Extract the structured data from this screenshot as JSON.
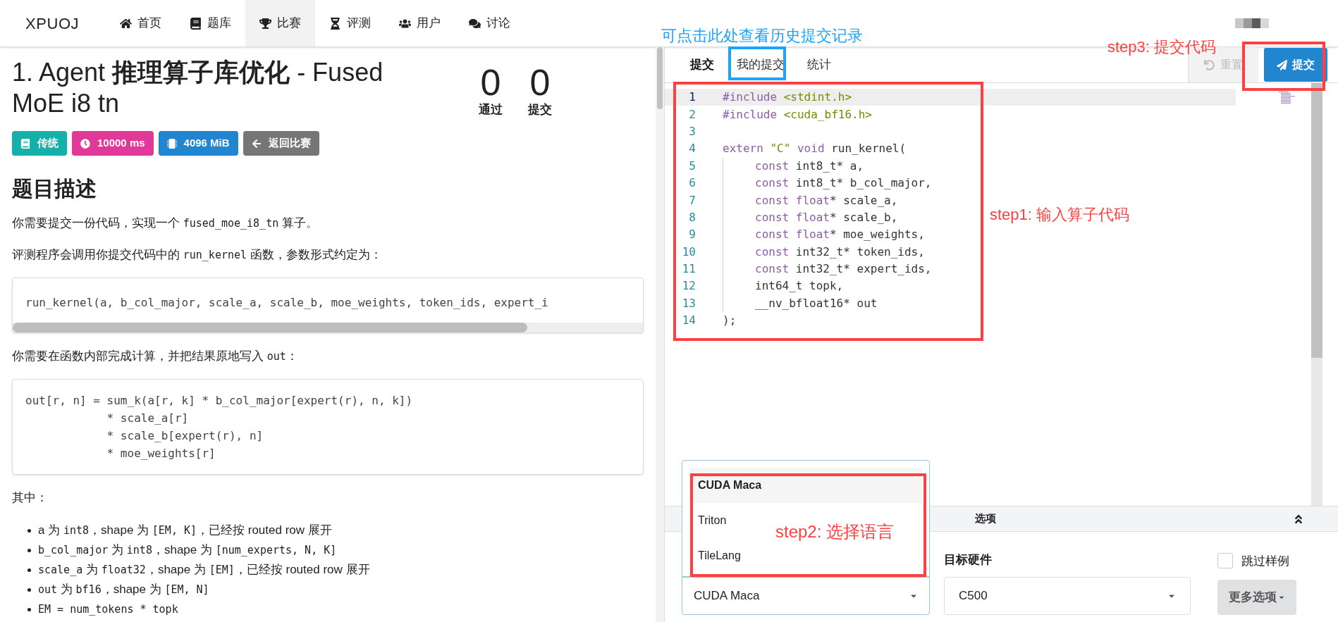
{
  "nav": {
    "logo": "XPUOJ",
    "items": [
      {
        "label": "首页",
        "selected": false
      },
      {
        "label": "题库",
        "selected": false
      },
      {
        "label": "比赛",
        "selected": true
      },
      {
        "label": "评测",
        "selected": false
      },
      {
        "label": "用户",
        "selected": false
      },
      {
        "label": "讨论",
        "selected": false
      }
    ]
  },
  "problem": {
    "title": "1. Agent **推理算子库优化** - Fused MoE i8 tn",
    "stats": [
      {
        "value": "0",
        "label": "通过"
      },
      {
        "value": "0",
        "label": "提交"
      }
    ],
    "badges": [
      {
        "label": "传统",
        "color": "#14b1ab"
      },
      {
        "label": "10000 ms",
        "color": "#e03997"
      },
      {
        "label": "4096 MiB",
        "color": "#2185d0"
      },
      {
        "label": "返回比赛",
        "color": "#767676"
      }
    ],
    "heading": "题目描述",
    "body": [
      {
        "kind": "paragraph",
        "segments": [
          {
            "kind": "text",
            "text": "你需要提交一份代码，实现一个 "
          },
          {
            "kind": "code",
            "text": "fused_moe_i8_tn"
          },
          {
            "kind": "text",
            "text": " 算子。"
          }
        ]
      },
      {
        "kind": "paragraph",
        "segments": [
          {
            "kind": "text",
            "text": "评测程序会调用你提交代码中的 "
          },
          {
            "kind": "code",
            "text": "run_kernel"
          },
          {
            "kind": "text",
            "text": " 函数，参数形式约定为："
          }
        ]
      },
      {
        "kind": "codeblock",
        "scrollbar": true,
        "lines": [
          "run_kernel(a, b_col_major, scale_a, scale_b, moe_weights, token_ids, expert_i"
        ]
      },
      {
        "kind": "paragraph",
        "segments": [
          {
            "kind": "text",
            "text": "你需要在函数内部完成计算，并把结果原地写入 "
          },
          {
            "kind": "code",
            "text": "out"
          },
          {
            "kind": "text",
            "text": "："
          }
        ]
      },
      {
        "kind": "codeblock",
        "scrollbar": false,
        "lines": [
          "out[r, n] = sum_k(a[r, k] * b_col_major[expert(r), n, k])",
          "            * scale_a[r]",
          "            * scale_b[expert(r), n]",
          "            * moe_weights[r]"
        ]
      },
      {
        "kind": "paragraph",
        "segments": [
          {
            "kind": "text",
            "text": "其中："
          }
        ]
      },
      {
        "kind": "list",
        "items": [
          [
            {
              "kind": "text",
              "text": "a 为 "
            },
            {
              "kind": "code",
              "text": "int8"
            },
            {
              "kind": "text",
              "text": "，shape 为 "
            },
            {
              "kind": "code",
              "text": "[EM, K]"
            },
            {
              "kind": "text",
              "text": "，已经按 routed row 展开"
            }
          ],
          [
            {
              "kind": "code",
              "text": "b_col_major"
            },
            {
              "kind": "text",
              "text": " 为 "
            },
            {
              "kind": "code",
              "text": "int8"
            },
            {
              "kind": "text",
              "text": "，shape 为 "
            },
            {
              "kind": "code",
              "text": "[num_experts, N, K]"
            }
          ],
          [
            {
              "kind": "code",
              "text": "scale_a"
            },
            {
              "kind": "text",
              "text": " 为 "
            },
            {
              "kind": "code",
              "text": "float32"
            },
            {
              "kind": "text",
              "text": "，shape 为 "
            },
            {
              "kind": "code",
              "text": "[EM]"
            },
            {
              "kind": "text",
              "text": "，已经按 routed row 展开"
            }
          ],
          [
            {
              "kind": "code",
              "text": "out"
            },
            {
              "kind": "text",
              "text": " 为 "
            },
            {
              "kind": "code",
              "text": "bf16"
            },
            {
              "kind": "text",
              "text": "，shape 为 "
            },
            {
              "kind": "code",
              "text": "[EM, N]"
            }
          ],
          [
            {
              "kind": "code",
              "text": "EM = num_tokens * topk"
            }
          ]
        ]
      }
    ]
  },
  "editor": {
    "tabs": [
      {
        "label": "提交",
        "selected": true
      },
      {
        "label": "我的提交",
        "selected": false
      },
      {
        "label": "统计",
        "selected": false
      }
    ],
    "reset": "重置",
    "submit": "提交",
    "lines": [
      {
        "number": "1",
        "active": true,
        "guide": false,
        "tokens": [
          {
            "kind": "keyword",
            "text": "#include "
          },
          {
            "kind": "string",
            "text": "<stdint.h>"
          }
        ]
      },
      {
        "number": "2",
        "active": false,
        "guide": false,
        "tokens": [
          {
            "kind": "keyword",
            "text": "#include "
          },
          {
            "kind": "string",
            "text": "<cuda_bf16.h>"
          }
        ]
      },
      {
        "number": "3",
        "active": false,
        "guide": false
      },
      {
        "number": "4",
        "active": false,
        "guide": false,
        "tokens": [
          {
            "kind": "keyword",
            "text": "extern "
          },
          {
            "kind": "string",
            "text": "\"C\""
          },
          {
            "kind": "keyword",
            "text": " void"
          },
          {
            "kind": "plain",
            "text": " run_kernel("
          }
        ]
      },
      {
        "number": "5",
        "active": false,
        "guide": true,
        "tokens": [
          {
            "kind": "keyword",
            "text": "const"
          },
          {
            "kind": "plain",
            "text": " int8_t* a,"
          }
        ]
      },
      {
        "number": "6",
        "active": false,
        "guide": true,
        "tokens": [
          {
            "kind": "keyword",
            "text": "const"
          },
          {
            "kind": "plain",
            "text": " int8_t* b_col_major,"
          }
        ]
      },
      {
        "number": "7",
        "active": false,
        "guide": true,
        "tokens": [
          {
            "kind": "keyword",
            "text": "const float"
          },
          {
            "kind": "plain",
            "text": "* scale_a,"
          }
        ]
      },
      {
        "number": "8",
        "active": false,
        "guide": true,
        "tokens": [
          {
            "kind": "keyword",
            "text": "const float"
          },
          {
            "kind": "plain",
            "text": "* scale_b,"
          }
        ]
      },
      {
        "number": "9",
        "active": false,
        "guide": true,
        "tokens": [
          {
            "kind": "keyword",
            "text": "const float"
          },
          {
            "kind": "plain",
            "text": "* moe_weights,"
          }
        ]
      },
      {
        "number": "10",
        "active": false,
        "guide": true,
        "tokens": [
          {
            "kind": "keyword",
            "text": "const"
          },
          {
            "kind": "plain",
            "text": " int32_t* token_ids,"
          }
        ]
      },
      {
        "number": "11",
        "active": false,
        "guide": true,
        "tokens": [
          {
            "kind": "keyword",
            "text": "const"
          },
          {
            "kind": "plain",
            "text": " int32_t* expert_ids,"
          }
        ]
      },
      {
        "number": "12",
        "active": false,
        "guide": true,
        "tokens": [
          {
            "kind": "plain",
            "text": "int64_t topk,"
          }
        ]
      },
      {
        "number": "13",
        "active": false,
        "guide": true,
        "tokens": [
          {
            "kind": "plain",
            "text": "__nv_bfloat16* out"
          }
        ]
      },
      {
        "number": "14",
        "active": false,
        "guide": false,
        "tokens": [
          {
            "kind": "plain",
            "text": ");"
          }
        ]
      }
    ],
    "options_title": "选项",
    "language": {
      "value": "CUDA Maca",
      "options": [
        {
          "label": "CUDA Maca",
          "selected": true
        },
        {
          "label": "Triton",
          "selected": false
        },
        {
          "label": "TileLang",
          "selected": false
        }
      ]
    },
    "hardware": {
      "label": "目标硬件",
      "value": "C500"
    },
    "skip_samples": {
      "label": "跳过样例",
      "checked": false
    },
    "more": "更多选项"
  },
  "annotations": [
    {
      "text": "可点击此处查看历史提交记录",
      "color": "#1aa3ff"
    },
    {
      "text": "step1: 输入算子代码",
      "color": "#ff4040"
    },
    {
      "text": "step2: 选择语言",
      "color": "#ff4040"
    },
    {
      "text": "step3: 提交代码",
      "color": "#ff4040"
    }
  ]
}
